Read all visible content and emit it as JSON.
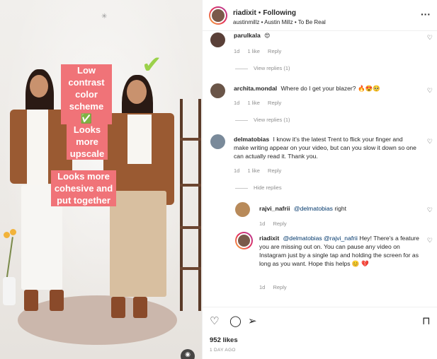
{
  "post": {
    "captions": [
      [
        "Low",
        "contrast",
        "color",
        "scheme ✅"
      ],
      [
        "Looks",
        "more",
        "upscale"
      ],
      [
        "Looks more",
        "cohesive and",
        "put together"
      ]
    ],
    "checkmark": "✔"
  },
  "header": {
    "username": "riadixit",
    "separator": "•",
    "follow_label": "Following",
    "audio_line": "austinmillz • Austin Millz • To Be Real",
    "more_icon": "more-horizontal-icon"
  },
  "comments": [
    {
      "username": "parulkala",
      "text": "😍",
      "time": "1d",
      "likes": "1 like",
      "reply_label": "Reply",
      "view_replies": "View replies (1)"
    },
    {
      "username": "archita.mondal",
      "text": "Where do I get your blazer? 🔥😍🥺",
      "time": "1d",
      "likes": "1 like",
      "reply_label": "Reply",
      "view_replies": "View replies (1)"
    },
    {
      "username": "delmatobias",
      "text": "I know it's the latest Trent to flick your finger and make writing appear on your video, but can you slow it down so one can actually read it. Thank you.",
      "time": "1d",
      "likes": "1 like",
      "reply_label": "Reply",
      "view_replies": "Hide replies"
    }
  ],
  "replies": [
    {
      "username": "rajvi_nafrii",
      "mention": "@delmatobias",
      "text": "right",
      "time": "1d",
      "reply_label": "Reply"
    },
    {
      "username": "riadixit",
      "mention": "@delmatobias @rajvi_nafrii",
      "text": "Hey! There's a feature you are missing out on. You can pause any video on Instagram just by a single tap and holding the screen for as long as you want. Hope this helps 😊 💔",
      "time": "1d",
      "reply_label": "Reply"
    }
  ],
  "footer": {
    "likes": "952 likes",
    "time_ago": "1 DAY AGO"
  }
}
